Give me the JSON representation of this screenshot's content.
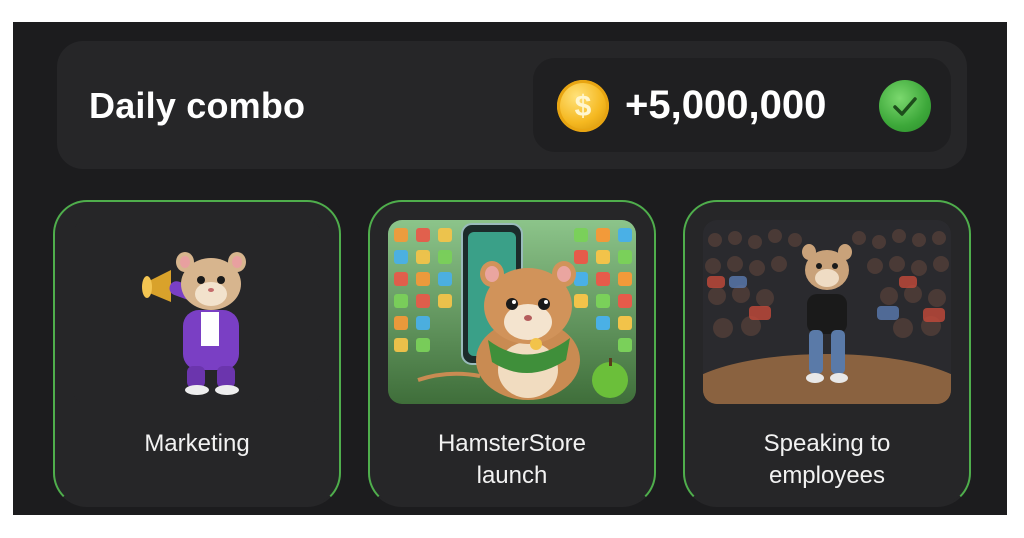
{
  "header": {
    "title": "Daily combo",
    "reward": "+5,000,000",
    "coin_icon": "dollar-coin-icon",
    "status_icon": "check-icon"
  },
  "cards": [
    {
      "label": "Marketing",
      "image": "hamster-purple-suit-megaphone"
    },
    {
      "label_line1": "HamsterStore",
      "label_line2": "launch",
      "image": "hamster-app-store"
    },
    {
      "label_line1": "Speaking to",
      "label_line2": "employees",
      "image": "hamster-stage-audience"
    }
  ],
  "colors": {
    "background": "#1c1c1e",
    "panel": "#262628",
    "accent_green": "#4fae4c",
    "coin_gold": "#f5b820"
  }
}
